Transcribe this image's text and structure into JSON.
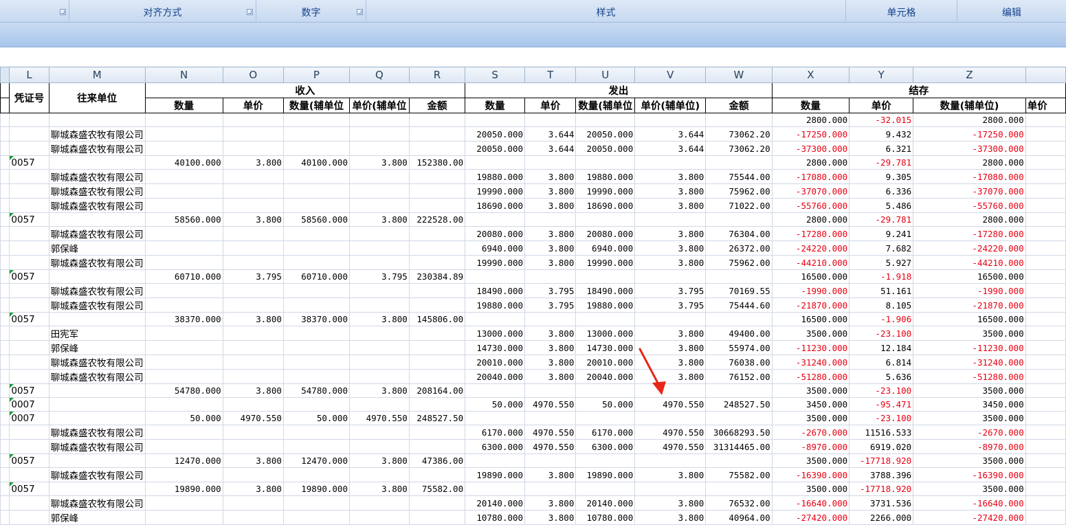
{
  "ribbon": {
    "groups": [
      "对齐方式",
      "数字",
      "样式",
      "单元格",
      "编辑"
    ]
  },
  "columns": [
    "L",
    "M",
    "N",
    "O",
    "P",
    "Q",
    "R",
    "S",
    "T",
    "U",
    "V",
    "W",
    "X",
    "Y",
    "Z"
  ],
  "header_row1": {
    "voucher": "凭证号",
    "partner": "往来单位",
    "income": "收入",
    "out": "发出",
    "balance": "结存"
  },
  "header_row2": {
    "income": [
      "数量",
      "单价",
      "数量(辅单位",
      "单价(辅单位",
      "金额"
    ],
    "out": [
      "数量",
      "单价",
      "数量(辅单位",
      "单价(辅单位)",
      "金额"
    ],
    "balance": [
      "数量",
      "单价",
      "数量(辅单位)",
      "单价"
    ]
  },
  "rows": [
    {
      "L": "",
      "M": "",
      "N": "",
      "O": "",
      "P": "",
      "Q": "",
      "R": "",
      "S": "",
      "T": "",
      "U": "",
      "V": "",
      "W": "",
      "X": "2800.000",
      "Y": "-32.015",
      "Z": "2800.000"
    },
    {
      "L": "",
      "M": "聊城森盛农牧有限公司",
      "N": "",
      "O": "",
      "P": "",
      "Q": "",
      "R": "",
      "S": "20050.000",
      "T": "3.644",
      "U": "20050.000",
      "V": "3.644",
      "W": "73062.20",
      "X": "-17250.000",
      "Y": "9.432",
      "Z": "-17250.000"
    },
    {
      "L": "",
      "M": "聊城森盛农牧有限公司",
      "N": "",
      "O": "",
      "P": "",
      "Q": "",
      "R": "",
      "S": "20050.000",
      "T": "3.644",
      "U": "20050.000",
      "V": "3.644",
      "W": "73062.20",
      "X": "-37300.000",
      "Y": "6.321",
      "Z": "-37300.000"
    },
    {
      "L": "0057",
      "M": "",
      "N": "40100.000",
      "O": "3.800",
      "P": "40100.000",
      "Q": "3.800",
      "R": "152380.00",
      "S": "",
      "T": "",
      "U": "",
      "V": "",
      "W": "",
      "X": "2800.000",
      "Y": "-29.781",
      "Z": "2800.000"
    },
    {
      "L": "",
      "M": "聊城森盛农牧有限公司",
      "N": "",
      "O": "",
      "P": "",
      "Q": "",
      "R": "",
      "S": "19880.000",
      "T": "3.800",
      "U": "19880.000",
      "V": "3.800",
      "W": "75544.00",
      "X": "-17080.000",
      "Y": "9.305",
      "Z": "-17080.000"
    },
    {
      "L": "",
      "M": "聊城森盛农牧有限公司",
      "N": "",
      "O": "",
      "P": "",
      "Q": "",
      "R": "",
      "S": "19990.000",
      "T": "3.800",
      "U": "19990.000",
      "V": "3.800",
      "W": "75962.00",
      "X": "-37070.000",
      "Y": "6.336",
      "Z": "-37070.000"
    },
    {
      "L": "",
      "M": "聊城森盛农牧有限公司",
      "N": "",
      "O": "",
      "P": "",
      "Q": "",
      "R": "",
      "S": "18690.000",
      "T": "3.800",
      "U": "18690.000",
      "V": "3.800",
      "W": "71022.00",
      "X": "-55760.000",
      "Y": "5.486",
      "Z": "-55760.000"
    },
    {
      "L": "0057",
      "M": "",
      "N": "58560.000",
      "O": "3.800",
      "P": "58560.000",
      "Q": "3.800",
      "R": "222528.00",
      "S": "",
      "T": "",
      "U": "",
      "V": "",
      "W": "",
      "X": "2800.000",
      "Y": "-29.781",
      "Z": "2800.000"
    },
    {
      "L": "",
      "M": "聊城森盛农牧有限公司",
      "N": "",
      "O": "",
      "P": "",
      "Q": "",
      "R": "",
      "S": "20080.000",
      "T": "3.800",
      "U": "20080.000",
      "V": "3.800",
      "W": "76304.00",
      "X": "-17280.000",
      "Y": "9.241",
      "Z": "-17280.000"
    },
    {
      "L": "",
      "M": "郭保峰",
      "N": "",
      "O": "",
      "P": "",
      "Q": "",
      "R": "",
      "S": "6940.000",
      "T": "3.800",
      "U": "6940.000",
      "V": "3.800",
      "W": "26372.00",
      "X": "-24220.000",
      "Y": "7.682",
      "Z": "-24220.000"
    },
    {
      "L": "",
      "M": "聊城森盛农牧有限公司",
      "N": "",
      "O": "",
      "P": "",
      "Q": "",
      "R": "",
      "S": "19990.000",
      "T": "3.800",
      "U": "19990.000",
      "V": "3.800",
      "W": "75962.00",
      "X": "-44210.000",
      "Y": "5.927",
      "Z": "-44210.000"
    },
    {
      "L": "0057",
      "M": "",
      "N": "60710.000",
      "O": "3.795",
      "P": "60710.000",
      "Q": "3.795",
      "R": "230384.89",
      "S": "",
      "T": "",
      "U": "",
      "V": "",
      "W": "",
      "X": "16500.000",
      "Y": "-1.918",
      "Z": "16500.000"
    },
    {
      "L": "",
      "M": "聊城森盛农牧有限公司",
      "N": "",
      "O": "",
      "P": "",
      "Q": "",
      "R": "",
      "S": "18490.000",
      "T": "3.795",
      "U": "18490.000",
      "V": "3.795",
      "W": "70169.55",
      "X": "-1990.000",
      "Y": "51.161",
      "Z": "-1990.000"
    },
    {
      "L": "",
      "M": "聊城森盛农牧有限公司",
      "N": "",
      "O": "",
      "P": "",
      "Q": "",
      "R": "",
      "S": "19880.000",
      "T": "3.795",
      "U": "19880.000",
      "V": "3.795",
      "W": "75444.60",
      "X": "-21870.000",
      "Y": "8.105",
      "Z": "-21870.000"
    },
    {
      "L": "0057",
      "M": "",
      "N": "38370.000",
      "O": "3.800",
      "P": "38370.000",
      "Q": "3.800",
      "R": "145806.00",
      "S": "",
      "T": "",
      "U": "",
      "V": "",
      "W": "",
      "X": "16500.000",
      "Y": "-1.906",
      "Z": "16500.000"
    },
    {
      "L": "",
      "M": "田宪军",
      "N": "",
      "O": "",
      "P": "",
      "Q": "",
      "R": "",
      "S": "13000.000",
      "T": "3.800",
      "U": "13000.000",
      "V": "3.800",
      "W": "49400.00",
      "X": "3500.000",
      "Y": "-23.100",
      "Z": "3500.000"
    },
    {
      "L": "",
      "M": "郭保峰",
      "N": "",
      "O": "",
      "P": "",
      "Q": "",
      "R": "",
      "S": "14730.000",
      "T": "3.800",
      "U": "14730.000",
      "V": "3.800",
      "W": "55974.00",
      "X": "-11230.000",
      "Y": "12.184",
      "Z": "-11230.000"
    },
    {
      "L": "",
      "M": "聊城森盛农牧有限公司",
      "N": "",
      "O": "",
      "P": "",
      "Q": "",
      "R": "",
      "S": "20010.000",
      "T": "3.800",
      "U": "20010.000",
      "V": "3.800",
      "W": "76038.00",
      "X": "-31240.000",
      "Y": "6.814",
      "Z": "-31240.000"
    },
    {
      "L": "",
      "M": "聊城森盛农牧有限公司",
      "N": "",
      "O": "",
      "P": "",
      "Q": "",
      "R": "",
      "S": "20040.000",
      "T": "3.800",
      "U": "20040.000",
      "V": "3.800",
      "W": "76152.00",
      "X": "-51280.000",
      "Y": "5.636",
      "Z": "-51280.000"
    },
    {
      "L": "0057",
      "M": "",
      "N": "54780.000",
      "O": "3.800",
      "P": "54780.000",
      "Q": "3.800",
      "R": "208164.00",
      "S": "",
      "T": "",
      "U": "",
      "V": "",
      "W": "",
      "X": "3500.000",
      "Y": "-23.100",
      "Z": "3500.000"
    },
    {
      "L": "0007",
      "M": "",
      "N": "",
      "O": "",
      "P": "",
      "Q": "",
      "R": "",
      "S": "50.000",
      "T": "4970.550",
      "U": "50.000",
      "V": "4970.550",
      "W": "248527.50",
      "X": "3450.000",
      "Y": "-95.471",
      "Z": "3450.000"
    },
    {
      "L": "0007",
      "M": "",
      "N": "50.000",
      "O": "4970.550",
      "P": "50.000",
      "Q": "4970.550",
      "R": "248527.50",
      "S": "",
      "T": "",
      "U": "",
      "V": "",
      "W": "",
      "X": "3500.000",
      "Y": "-23.100",
      "Z": "3500.000"
    },
    {
      "L": "",
      "M": "聊城森盛农牧有限公司",
      "N": "",
      "O": "",
      "P": "",
      "Q": "",
      "R": "",
      "S": "6170.000",
      "T": "4970.550",
      "U": "6170.000",
      "V": "4970.550",
      "W": "30668293.50",
      "X": "-2670.000",
      "Y": "11516.533",
      "Z": "-2670.000"
    },
    {
      "L": "",
      "M": "聊城森盛农牧有限公司",
      "N": "",
      "O": "",
      "P": "",
      "Q": "",
      "R": "",
      "S": "6300.000",
      "T": "4970.550",
      "U": "6300.000",
      "V": "4970.550",
      "W": "31314465.00",
      "X": "-8970.000",
      "Y": "6919.020",
      "Z": "-8970.000"
    },
    {
      "L": "0057",
      "M": "",
      "N": "12470.000",
      "O": "3.800",
      "P": "12470.000",
      "Q": "3.800",
      "R": "47386.00",
      "S": "",
      "T": "",
      "U": "",
      "V": "",
      "W": "",
      "X": "3500.000",
      "Y": "-17718.920",
      "Z": "3500.000"
    },
    {
      "L": "",
      "M": "聊城森盛农牧有限公司",
      "N": "",
      "O": "",
      "P": "",
      "Q": "",
      "R": "",
      "S": "19890.000",
      "T": "3.800",
      "U": "19890.000",
      "V": "3.800",
      "W": "75582.00",
      "X": "-16390.000",
      "Y": "3788.396",
      "Z": "-16390.000"
    },
    {
      "L": "0057",
      "M": "",
      "N": "19890.000",
      "O": "3.800",
      "P": "19890.000",
      "Q": "3.800",
      "R": "75582.00",
      "S": "",
      "T": "",
      "U": "",
      "V": "",
      "W": "",
      "X": "3500.000",
      "Y": "-17718.920",
      "Z": "3500.000"
    },
    {
      "L": "",
      "M": "聊城森盛农牧有限公司",
      "N": "",
      "O": "",
      "P": "",
      "Q": "",
      "R": "",
      "S": "20140.000",
      "T": "3.800",
      "U": "20140.000",
      "V": "3.800",
      "W": "76532.00",
      "X": "-16640.000",
      "Y": "3731.536",
      "Z": "-16640.000"
    },
    {
      "L": "",
      "M": "郭保峰",
      "N": "",
      "O": "",
      "P": "",
      "Q": "",
      "R": "",
      "S": "10780.000",
      "T": "3.800",
      "U": "10780.000",
      "V": "3.800",
      "W": "40964.00",
      "X": "-27420.000",
      "Y": "2266.000",
      "Z": "-27420.000"
    }
  ],
  "colors": {
    "negative": "#e60012",
    "ribbon_text": "#15428b",
    "annotation_arrow": "#e8261a"
  },
  "annotation": {
    "icon": "red-arrow-icon"
  }
}
